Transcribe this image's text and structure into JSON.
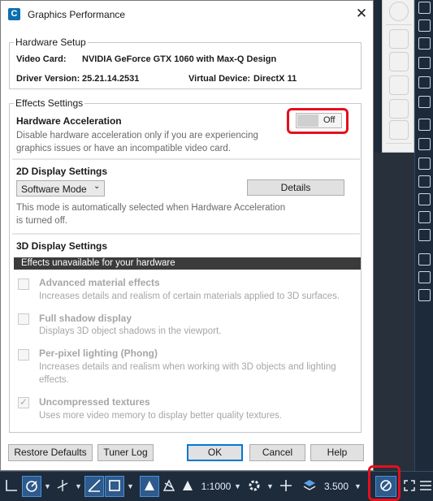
{
  "dialog": {
    "title": "Graphics Performance",
    "close_glyph": "✕",
    "app_icon_letter": "C"
  },
  "hardware_setup": {
    "legend": "Hardware Setup",
    "video_card_label": "Video Card:",
    "video_card_value": "NVIDIA GeForce GTX 1060 with Max-Q Design",
    "driver_label": "Driver Version:",
    "driver_value": "25.21.14.2531",
    "virtual_device_label": "Virtual Device:",
    "virtual_device_value": "DirectX 11"
  },
  "effects": {
    "legend": "Effects Settings",
    "hw_accel_title": "Hardware Acceleration",
    "hw_accel_desc_line1": "Disable hardware acceleration only if you are experiencing",
    "hw_accel_desc_line2": "graphics issues or have an incompatible video card.",
    "hw_accel_toggle": "Off",
    "display_2d_title": "2D Display Settings",
    "mode_dropdown": "Software Mode",
    "details_button": "Details",
    "mode_note_line1": "This mode is automatically selected when Hardware Acceleration",
    "mode_note_line2": "is turned off.",
    "display_3d_title": "3D Display Settings",
    "unavailable_banner": "Effects unavailable for your hardware",
    "options": [
      {
        "title": "Advanced material effects",
        "desc1": "Increases details and realism of certain materials applied to 3D surfaces.",
        "desc2": "",
        "checked": false
      },
      {
        "title": "Full shadow display",
        "desc1": "Displays 3D object shadows in the viewport.",
        "desc2": "",
        "checked": false
      },
      {
        "title": "Per-pixel lighting (Phong)",
        "desc1": "Increases details and realism when working with 3D objects and lighting",
        "desc2": "effects.",
        "checked": false
      },
      {
        "title": "Uncompressed textures",
        "desc1": "Uses more video memory to display better quality textures.",
        "desc2": "",
        "checked": true
      }
    ]
  },
  "buttons": {
    "restore_defaults": "Restore Defaults",
    "tuner_log": "Tuner Log",
    "ok": "OK",
    "cancel": "Cancel",
    "help": "Help"
  },
  "statusbar": {
    "scale": "1:1000",
    "zoom_value": "3.500",
    "icons": [
      "snap-icon",
      "polar-tracking-icon",
      "osnap-tracking-icon",
      "lineweight-icon",
      "selection-cycling-icon",
      "annotation-scale-icon",
      "workspace-gear-icon",
      "plus-icon",
      "hardware-acceleration-icon",
      "fullscreen-icon",
      "menu-icon"
    ]
  },
  "colors": {
    "highlight": "#e4101e",
    "dark_banner": "#3b3b3b",
    "statusbar_bg": "#1e2b3a",
    "default_button_border": "#0078d7"
  }
}
